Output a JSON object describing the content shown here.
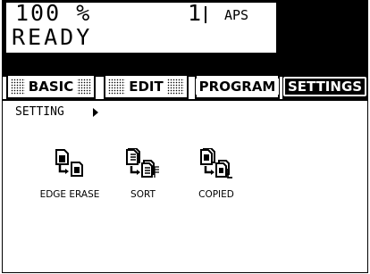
{
  "status": {
    "count": "100 %",
    "quantity": "1",
    "paper": "APS",
    "state": "READY"
  },
  "tabs": [
    {
      "label": "BASIC",
      "active": false
    },
    {
      "label": "EDIT",
      "active": false
    },
    {
      "label": "PROGRAM",
      "active": false
    },
    {
      "label": "SETTINGS",
      "active": true
    }
  ],
  "breadcrumb": "SETTING",
  "functions": [
    {
      "label": "EDGE ERASE",
      "icon": "edge-erase-icon"
    },
    {
      "label": "SORT",
      "icon": "sort-icon"
    },
    {
      "label": "COPIED",
      "icon": "copied-icon"
    }
  ]
}
